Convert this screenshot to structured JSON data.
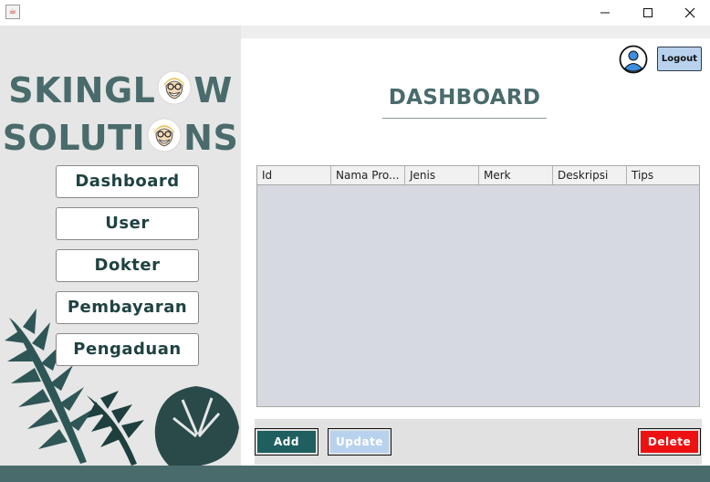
{
  "window": {
    "icon": "java-cup-icon",
    "controls": [
      "minimize-icon",
      "maximize-icon",
      "close-icon"
    ]
  },
  "brand": {
    "line1_pre": "SKINGL",
    "line1_post": "W",
    "line2_pre": "SOLUTI",
    "line2_post": "NS"
  },
  "nav": {
    "items": [
      {
        "label": "Dashboard"
      },
      {
        "label": "User"
      },
      {
        "label": "Dokter"
      },
      {
        "label": "Pembayaran"
      },
      {
        "label": "Pengaduan"
      }
    ]
  },
  "header": {
    "logout_label": "Logout",
    "title": "DASHBOARD"
  },
  "table": {
    "columns": [
      "Id",
      "Nama Pro...",
      "Jenis",
      "Merk",
      "Deskripsi",
      "Tips"
    ],
    "rows": []
  },
  "actions": {
    "add_label": "Add",
    "update_label": "Update",
    "delete_label": "Delete"
  },
  "colors": {
    "brand": "#4a6b6b",
    "add": "#1f5f5f",
    "update": "#b8d2ee",
    "delete": "#ee1111",
    "footer": "#4a6b6b"
  }
}
